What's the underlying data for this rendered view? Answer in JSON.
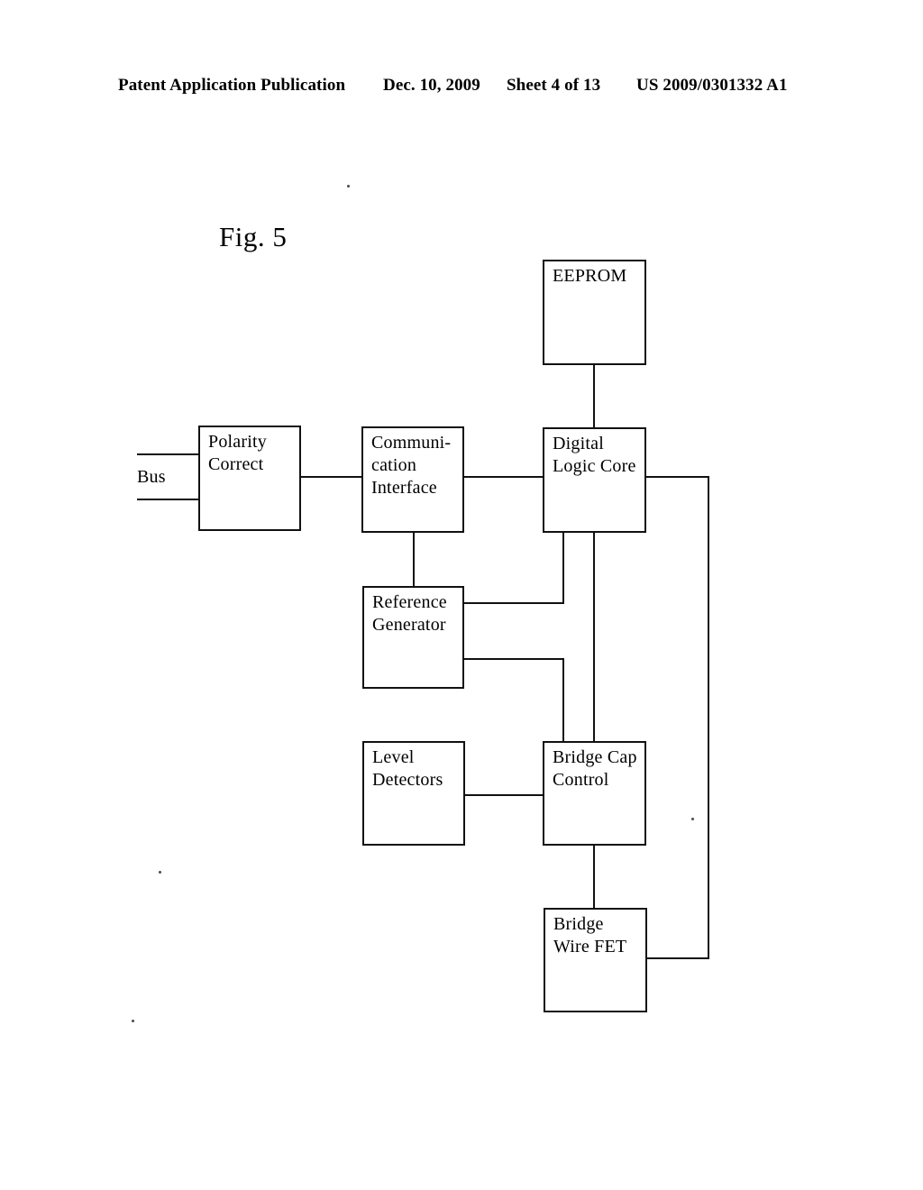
{
  "header": {
    "publication": "Patent Application Publication",
    "date": "Dec. 10, 2009",
    "sheet": "Sheet 4 of 13",
    "patent_number": "US 2009/0301332 A1"
  },
  "figure": {
    "label": "Fig. 5",
    "port_label": "Bus"
  },
  "diagram": {
    "type": "block-diagram",
    "nodes": [
      {
        "id": "eeprom",
        "label": "EEPROM"
      },
      {
        "id": "polarity",
        "label": "Polarity\nCorrect"
      },
      {
        "id": "comm_interface",
        "label": "Communi-\ncation\nInterface"
      },
      {
        "id": "digital_core",
        "label": "Digital\nLogic Core"
      },
      {
        "id": "ref_generator",
        "label": "Reference\nGenerator"
      },
      {
        "id": "level_detectors",
        "label": "Level\nDetectors"
      },
      {
        "id": "bridge_cap",
        "label": "Bridge Cap\nControl"
      },
      {
        "id": "bridge_fet",
        "label": "Bridge\nWire FET"
      }
    ],
    "edges": [
      {
        "from": "bus",
        "to": "polarity"
      },
      {
        "from": "polarity",
        "to": "comm_interface"
      },
      {
        "from": "comm_interface",
        "to": "digital_core"
      },
      {
        "from": "comm_interface",
        "to": "ref_generator"
      },
      {
        "from": "eeprom",
        "to": "digital_core"
      },
      {
        "from": "digital_core",
        "to": "ref_generator"
      },
      {
        "from": "digital_core",
        "to": "bridge_cap"
      },
      {
        "from": "ref_generator",
        "to": "bridge_cap"
      },
      {
        "from": "level_detectors",
        "to": "bridge_cap"
      },
      {
        "from": "bridge_cap",
        "to": "bridge_fet"
      },
      {
        "from": "digital_core",
        "to": "bridge_fet"
      }
    ]
  },
  "colors": {
    "ink": "#111111",
    "page": "#ffffff"
  }
}
